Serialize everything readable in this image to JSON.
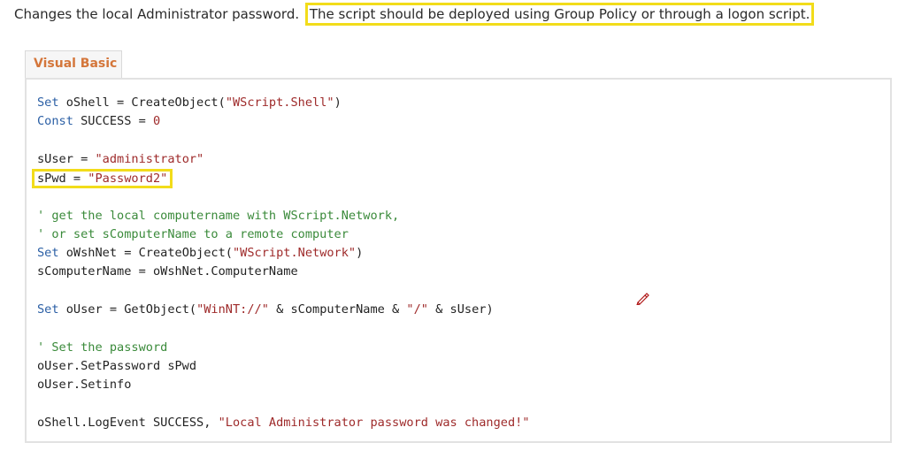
{
  "intro": {
    "plain": "Changes the local Administrator password. ",
    "highlighted": "The script should be deployed using Group Policy or through a logon script."
  },
  "tab": {
    "label": "Visual Basic"
  },
  "code": {
    "l1_kw": "Set",
    "l1_rest": " oShell = CreateObject(",
    "l1_str": "\"WScript.Shell\"",
    "l1_end": ")",
    "l2_kw": "Const",
    "l2_rest": " SUCCESS = ",
    "l2_num": "0",
    "l3_var": "sUser = ",
    "l3_str": "\"administrator\"",
    "l4_var": "sPwd = ",
    "l4_str": "\"Password2\"",
    "l5_cmt": "' get the local computername with WScript.Network,",
    "l6_cmt": "' or set sComputerName to a remote computer",
    "l7_kw": "Set",
    "l7_rest": " oWshNet = CreateObject(",
    "l7_str": "\"WScript.Network\"",
    "l7_end": ")",
    "l8": "sComputerName = oWshNet.ComputerName",
    "l9_kw": "Set",
    "l9_rest": " oUser = GetObject(",
    "l9_str1": "\"WinNT://\"",
    "l9_mid1": " & sComputerName & ",
    "l9_str2": "\"/\"",
    "l9_mid2": " & sUser)",
    "l10_cmt": "' Set the password",
    "l11": "oUser.SetPassword sPwd",
    "l12": "oUser.Setinfo",
    "l13_rest": "oShell.LogEvent SUCCESS, ",
    "l13_str": "\"Local Administrator password was changed!\""
  },
  "colors": {
    "highlight_border": "#f2dc1a",
    "keyword": "#2b5fa5",
    "string": "#9e2a2a",
    "comment": "#3a8a3a",
    "tab_label": "#d4763a"
  },
  "icons": {
    "cursor": "pen-cursor-icon"
  }
}
